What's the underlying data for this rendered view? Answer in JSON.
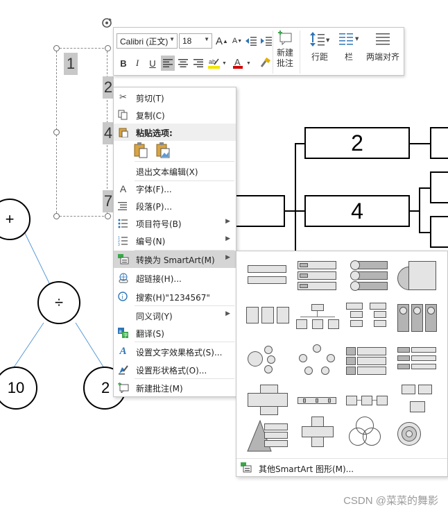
{
  "canvas": {
    "tree": {
      "root": "+",
      "middle": "÷",
      "left_leaf": "10",
      "right_leaf": "2"
    },
    "diagram": {
      "box_top": "2",
      "box_middle": "4"
    },
    "textbox_numbers": [
      "1",
      "2",
      "4",
      "7"
    ]
  },
  "mini_toolbar": {
    "font_name": "Calibri (正文)",
    "font_size": "18",
    "grow_font": "A",
    "shrink_font": "A",
    "bold": "B",
    "italic": "I",
    "underline": "U",
    "font_color_letter": "A",
    "new_comment_label": "新建\n批注",
    "line_spacing_label": "行距",
    "columns_label": "栏",
    "distributed_label": "两端对齐",
    "highlight_color": "#f2e600",
    "font_color": "#d00000"
  },
  "context_menu": {
    "items": [
      {
        "label": "剪切(T)",
        "icon": "scissors-icon"
      },
      {
        "label": "复制(C)",
        "icon": "copy-icon"
      },
      {
        "label": "粘贴选项:",
        "icon": "paste-icon"
      },
      {
        "label": "退出文本编辑(X)",
        "icon": ""
      },
      {
        "label": "字体(F)...",
        "icon": "font-icon"
      },
      {
        "label": "段落(P)...",
        "icon": "paragraph-icon"
      },
      {
        "label": "项目符号(B)",
        "icon": "bullets-icon"
      },
      {
        "label": "编号(N)",
        "icon": "numbering-icon"
      },
      {
        "label": "转换为 SmartArt(M)",
        "icon": "smartart-icon"
      },
      {
        "label": "超链接(H)...",
        "icon": "link-icon"
      },
      {
        "label": "搜索(H)\"1234567\"",
        "icon": "search-icon"
      },
      {
        "label": "同义词(Y)",
        "icon": ""
      },
      {
        "label": "翻译(S)",
        "icon": "translate-icon"
      },
      {
        "label": "设置文字效果格式(S)...",
        "icon": "text-effects-icon"
      },
      {
        "label": "设置形状格式(O)...",
        "icon": "shape-format-icon"
      },
      {
        "label": "新建批注(M)",
        "icon": "comment-icon"
      }
    ]
  },
  "smartart_submenu": {
    "footer_label": "其他SmartArt 图形(M)..."
  },
  "watermark": "CSDN @菜菜的舞影"
}
